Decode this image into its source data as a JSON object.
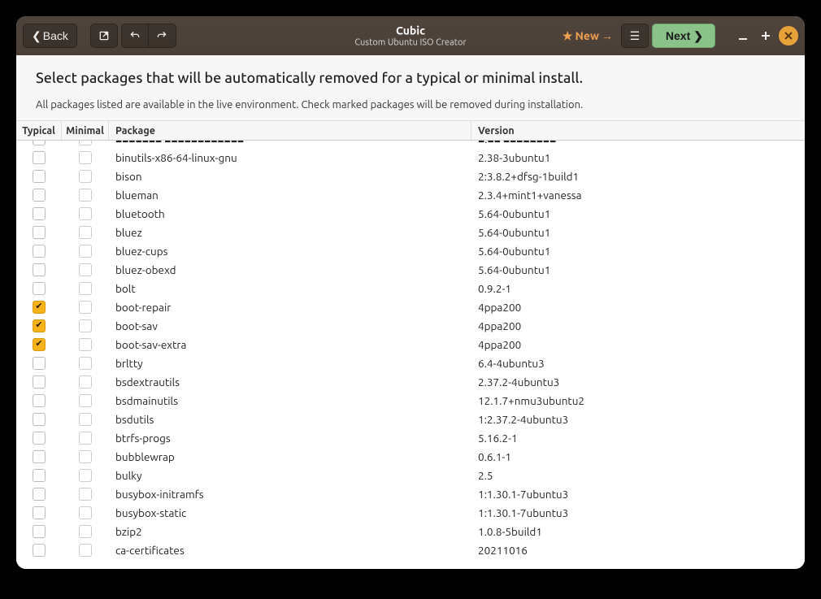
{
  "titlebar": {
    "back_label": "Back",
    "title": "Cubic",
    "subtitle": "Custom Ubuntu ISO Creator",
    "new_label": "New",
    "next_label": "Next"
  },
  "header": {
    "heading": "Select packages that will be automatically removed for a typical or minimal install.",
    "description": "All packages listed are available in the live environment. Check marked packages will be removed during installation."
  },
  "table": {
    "columns": {
      "typical": "Typical",
      "minimal": "Minimal",
      "package": "Package",
      "version": "Version"
    },
    "rows": [
      {
        "typical": false,
        "minimal": false,
        "package": "binutils-x86-64-linux-gnu",
        "version": "2.38-3ubuntu1"
      },
      {
        "typical": false,
        "minimal": false,
        "package": "bison",
        "version": "2:3.8.2+dfsg-1build1"
      },
      {
        "typical": false,
        "minimal": false,
        "package": "blueman",
        "version": "2.3.4+mint1+vanessa"
      },
      {
        "typical": false,
        "minimal": false,
        "package": "bluetooth",
        "version": "5.64-0ubuntu1"
      },
      {
        "typical": false,
        "minimal": false,
        "package": "bluez",
        "version": "5.64-0ubuntu1"
      },
      {
        "typical": false,
        "minimal": false,
        "package": "bluez-cups",
        "version": "5.64-0ubuntu1"
      },
      {
        "typical": false,
        "minimal": false,
        "package": "bluez-obexd",
        "version": "5.64-0ubuntu1"
      },
      {
        "typical": false,
        "minimal": false,
        "package": "bolt",
        "version": "0.9.2-1"
      },
      {
        "typical": true,
        "minimal": false,
        "package": "boot-repair",
        "version": "4ppa200"
      },
      {
        "typical": true,
        "minimal": false,
        "package": "boot-sav",
        "version": "4ppa200"
      },
      {
        "typical": true,
        "minimal": false,
        "package": "boot-sav-extra",
        "version": "4ppa200"
      },
      {
        "typical": false,
        "minimal": false,
        "package": "brltty",
        "version": "6.4-4ubuntu3"
      },
      {
        "typical": false,
        "minimal": false,
        "package": "bsdextrautils",
        "version": "2.37.2-4ubuntu3"
      },
      {
        "typical": false,
        "minimal": false,
        "package": "bsdmainutils",
        "version": "12.1.7+nmu3ubuntu2"
      },
      {
        "typical": false,
        "minimal": false,
        "package": "bsdutils",
        "version": "1:2.37.2-4ubuntu3"
      },
      {
        "typical": false,
        "minimal": false,
        "package": "btrfs-progs",
        "version": "5.16.2-1"
      },
      {
        "typical": false,
        "minimal": false,
        "package": "bubblewrap",
        "version": "0.6.1-1"
      },
      {
        "typical": false,
        "minimal": false,
        "package": "bulky",
        "version": "2.5"
      },
      {
        "typical": false,
        "minimal": false,
        "package": "busybox-initramfs",
        "version": "1:1.30.1-7ubuntu3"
      },
      {
        "typical": false,
        "minimal": false,
        "package": "busybox-static",
        "version": "1:1.30.1-7ubuntu3"
      },
      {
        "typical": false,
        "minimal": false,
        "package": "bzip2",
        "version": "1.0.8-5build1"
      },
      {
        "typical": false,
        "minimal": false,
        "package": "ca-certificates",
        "version": "20211016"
      }
    ]
  }
}
